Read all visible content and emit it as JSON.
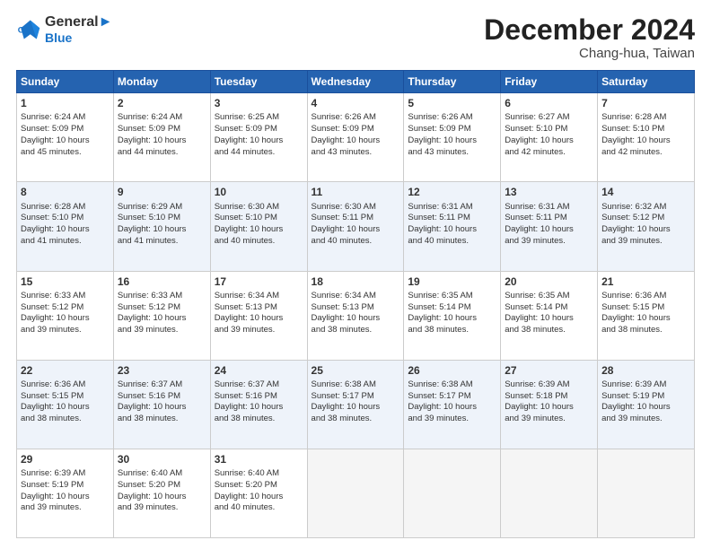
{
  "header": {
    "logo_line1": "General",
    "logo_line2": "Blue",
    "month": "December 2024",
    "location": "Chang-hua, Taiwan"
  },
  "weekdays": [
    "Sunday",
    "Monday",
    "Tuesday",
    "Wednesday",
    "Thursday",
    "Friday",
    "Saturday"
  ],
  "weeks": [
    [
      {
        "day": "1",
        "lines": [
          "Sunrise: 6:24 AM",
          "Sunset: 5:09 PM",
          "Daylight: 10 hours",
          "and 45 minutes."
        ]
      },
      {
        "day": "2",
        "lines": [
          "Sunrise: 6:24 AM",
          "Sunset: 5:09 PM",
          "Daylight: 10 hours",
          "and 44 minutes."
        ]
      },
      {
        "day": "3",
        "lines": [
          "Sunrise: 6:25 AM",
          "Sunset: 5:09 PM",
          "Daylight: 10 hours",
          "and 44 minutes."
        ]
      },
      {
        "day": "4",
        "lines": [
          "Sunrise: 6:26 AM",
          "Sunset: 5:09 PM",
          "Daylight: 10 hours",
          "and 43 minutes."
        ]
      },
      {
        "day": "5",
        "lines": [
          "Sunrise: 6:26 AM",
          "Sunset: 5:09 PM",
          "Daylight: 10 hours",
          "and 43 minutes."
        ]
      },
      {
        "day": "6",
        "lines": [
          "Sunrise: 6:27 AM",
          "Sunset: 5:10 PM",
          "Daylight: 10 hours",
          "and 42 minutes."
        ]
      },
      {
        "day": "7",
        "lines": [
          "Sunrise: 6:28 AM",
          "Sunset: 5:10 PM",
          "Daylight: 10 hours",
          "and 42 minutes."
        ]
      }
    ],
    [
      {
        "day": "8",
        "lines": [
          "Sunrise: 6:28 AM",
          "Sunset: 5:10 PM",
          "Daylight: 10 hours",
          "and 41 minutes."
        ]
      },
      {
        "day": "9",
        "lines": [
          "Sunrise: 6:29 AM",
          "Sunset: 5:10 PM",
          "Daylight: 10 hours",
          "and 41 minutes."
        ]
      },
      {
        "day": "10",
        "lines": [
          "Sunrise: 6:30 AM",
          "Sunset: 5:10 PM",
          "Daylight: 10 hours",
          "and 40 minutes."
        ]
      },
      {
        "day": "11",
        "lines": [
          "Sunrise: 6:30 AM",
          "Sunset: 5:11 PM",
          "Daylight: 10 hours",
          "and 40 minutes."
        ]
      },
      {
        "day": "12",
        "lines": [
          "Sunrise: 6:31 AM",
          "Sunset: 5:11 PM",
          "Daylight: 10 hours",
          "and 40 minutes."
        ]
      },
      {
        "day": "13",
        "lines": [
          "Sunrise: 6:31 AM",
          "Sunset: 5:11 PM",
          "Daylight: 10 hours",
          "and 39 minutes."
        ]
      },
      {
        "day": "14",
        "lines": [
          "Sunrise: 6:32 AM",
          "Sunset: 5:12 PM",
          "Daylight: 10 hours",
          "and 39 minutes."
        ]
      }
    ],
    [
      {
        "day": "15",
        "lines": [
          "Sunrise: 6:33 AM",
          "Sunset: 5:12 PM",
          "Daylight: 10 hours",
          "and 39 minutes."
        ]
      },
      {
        "day": "16",
        "lines": [
          "Sunrise: 6:33 AM",
          "Sunset: 5:12 PM",
          "Daylight: 10 hours",
          "and 39 minutes."
        ]
      },
      {
        "day": "17",
        "lines": [
          "Sunrise: 6:34 AM",
          "Sunset: 5:13 PM",
          "Daylight: 10 hours",
          "and 39 minutes."
        ]
      },
      {
        "day": "18",
        "lines": [
          "Sunrise: 6:34 AM",
          "Sunset: 5:13 PM",
          "Daylight: 10 hours",
          "and 38 minutes."
        ]
      },
      {
        "day": "19",
        "lines": [
          "Sunrise: 6:35 AM",
          "Sunset: 5:14 PM",
          "Daylight: 10 hours",
          "and 38 minutes."
        ]
      },
      {
        "day": "20",
        "lines": [
          "Sunrise: 6:35 AM",
          "Sunset: 5:14 PM",
          "Daylight: 10 hours",
          "and 38 minutes."
        ]
      },
      {
        "day": "21",
        "lines": [
          "Sunrise: 6:36 AM",
          "Sunset: 5:15 PM",
          "Daylight: 10 hours",
          "and 38 minutes."
        ]
      }
    ],
    [
      {
        "day": "22",
        "lines": [
          "Sunrise: 6:36 AM",
          "Sunset: 5:15 PM",
          "Daylight: 10 hours",
          "and 38 minutes."
        ]
      },
      {
        "day": "23",
        "lines": [
          "Sunrise: 6:37 AM",
          "Sunset: 5:16 PM",
          "Daylight: 10 hours",
          "and 38 minutes."
        ]
      },
      {
        "day": "24",
        "lines": [
          "Sunrise: 6:37 AM",
          "Sunset: 5:16 PM",
          "Daylight: 10 hours",
          "and 38 minutes."
        ]
      },
      {
        "day": "25",
        "lines": [
          "Sunrise: 6:38 AM",
          "Sunset: 5:17 PM",
          "Daylight: 10 hours",
          "and 38 minutes."
        ]
      },
      {
        "day": "26",
        "lines": [
          "Sunrise: 6:38 AM",
          "Sunset: 5:17 PM",
          "Daylight: 10 hours",
          "and 39 minutes."
        ]
      },
      {
        "day": "27",
        "lines": [
          "Sunrise: 6:39 AM",
          "Sunset: 5:18 PM",
          "Daylight: 10 hours",
          "and 39 minutes."
        ]
      },
      {
        "day": "28",
        "lines": [
          "Sunrise: 6:39 AM",
          "Sunset: 5:19 PM",
          "Daylight: 10 hours",
          "and 39 minutes."
        ]
      }
    ],
    [
      {
        "day": "29",
        "lines": [
          "Sunrise: 6:39 AM",
          "Sunset: 5:19 PM",
          "Daylight: 10 hours",
          "and 39 minutes."
        ]
      },
      {
        "day": "30",
        "lines": [
          "Sunrise: 6:40 AM",
          "Sunset: 5:20 PM",
          "Daylight: 10 hours",
          "and 39 minutes."
        ]
      },
      {
        "day": "31",
        "lines": [
          "Sunrise: 6:40 AM",
          "Sunset: 5:20 PM",
          "Daylight: 10 hours",
          "and 40 minutes."
        ]
      },
      null,
      null,
      null,
      null
    ]
  ]
}
